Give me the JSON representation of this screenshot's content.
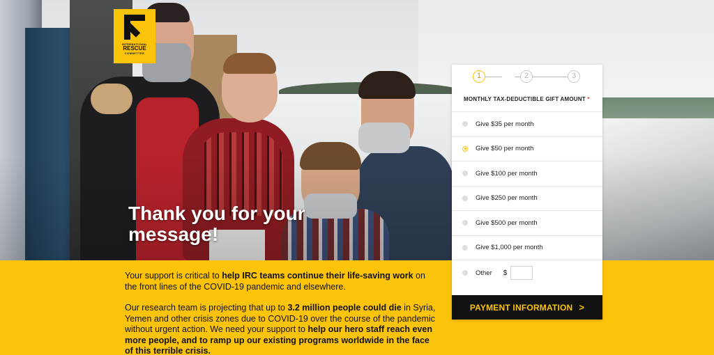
{
  "logo": {
    "top": "INTERNATIONAL",
    "main_line1": "RESCUE",
    "bottom": "COMMITTEE"
  },
  "hero": {
    "headline": "Thank you for your message!"
  },
  "body": {
    "p1": [
      {
        "t": "Your support is critical to ",
        "b": false
      },
      {
        "t": "help IRC teams continue their life-saving work",
        "b": true
      },
      {
        "t": " on the front lines of the COVID-19 pandemic and elsewhere.",
        "b": false
      }
    ],
    "p2": [
      {
        "t": "Our research team is projecting that up to ",
        "b": false
      },
      {
        "t": "3.2 million people could die",
        "b": true
      },
      {
        "t": " in Syria, Yemen and other crisis zones due to COVID-19 over the course of the pandemic without urgent action. We need your support to ",
        "b": false
      },
      {
        "t": "help our hero staff reach even more people, and to ramp up our existing programs worldwide in the face of this terrible crisis.",
        "b": true
      }
    ]
  },
  "donation": {
    "steps": [
      "1",
      "2",
      "3"
    ],
    "active_step": 1,
    "amount_title": "MONTHLY TAX-DEDUCTIBLE GIFT AMOUNT",
    "required_mark": "*",
    "options": [
      {
        "label": "Give $35 per month",
        "selected": false
      },
      {
        "label": "Give $50 per month",
        "selected": true
      },
      {
        "label": "Give $100 per month",
        "selected": false
      },
      {
        "label": "Give $250 per month",
        "selected": false
      },
      {
        "label": "Give $500 per month",
        "selected": false
      },
      {
        "label": "Give $1,000 per month",
        "selected": false
      }
    ],
    "other_label": "Other",
    "currency_symbol": "$",
    "other_value": "",
    "cta": "PAYMENT INFORMATION",
    "cta_icon": "chevron-right-icon"
  },
  "colors": {
    "brand_yellow": "#fcc30b",
    "cta_bg": "#111111"
  }
}
